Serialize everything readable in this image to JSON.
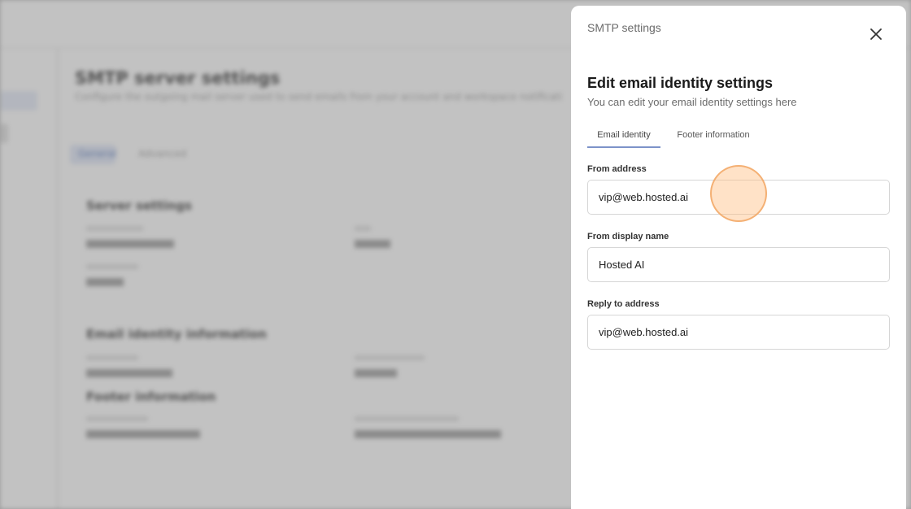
{
  "background": {
    "title": "SMTP server settings",
    "subtitle": "Configure the outgoing mail server used to send emails from your account and workspace notifications",
    "tabs": [
      "General",
      "Advanced"
    ],
    "sections": [
      "Server settings",
      "Email identity information",
      "Footer information"
    ]
  },
  "drawer": {
    "caption": "SMTP settings",
    "heading": "Edit email identity settings",
    "description": "You can edit your email identity settings here",
    "tabs": [
      {
        "label": "Email identity",
        "active": true
      },
      {
        "label": "Footer information",
        "active": false
      }
    ],
    "fields": {
      "from_address": {
        "label": "From address",
        "value": "vip@web.hosted.ai"
      },
      "from_display_name": {
        "label": "From display name",
        "value": "Hosted AI"
      },
      "reply_to_address": {
        "label": "Reply to address",
        "value": "vip@web.hosted.ai"
      }
    },
    "icons": {
      "close": "close-icon"
    }
  }
}
